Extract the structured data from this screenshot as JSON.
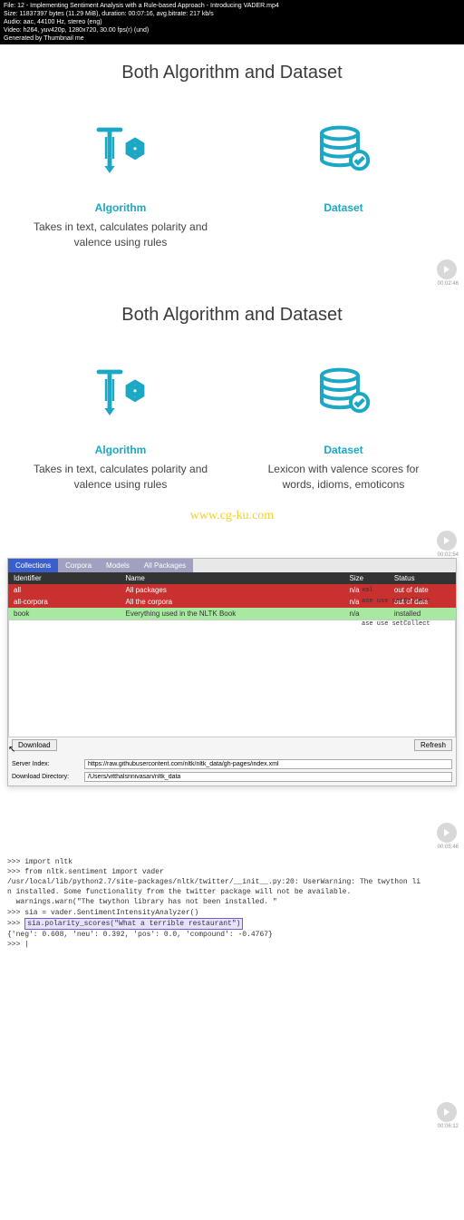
{
  "meta": {
    "file": "File: 12 - Implementing Sentiment Analysis with a Rule-based Approach - Introducing VADER.mp4",
    "size": "Size: 11837397 bytes (11.29 MiB), duration: 00:07:16, avg.bitrate: 217 kb/s",
    "audio": "Audio: aac, 44100 Hz, stereo (eng)",
    "video": "Video: h264, yuv420p, 1280x720, 30.00 fps(r) (und)",
    "gen": "Generated by Thumbnail me"
  },
  "slide1": {
    "title": "Both Algorithm and Dataset",
    "left": {
      "label": "Algorithm",
      "desc": "Takes in text, calculates polarity and valence using rules"
    },
    "right": {
      "label": "Dataset",
      "desc": ""
    },
    "timestamp": "00:02:46"
  },
  "slide2": {
    "title": "Both Algorithm and Dataset",
    "left": {
      "label": "Algorithm",
      "desc": "Takes in text, calculates polarity and valence using rules"
    },
    "right": {
      "label": "Dataset",
      "desc": "Lexicon with valence scores for words, idioms, emoticons"
    },
    "timestamp": "00:02:54"
  },
  "watermark": "www.cg-ku.com",
  "nltk": {
    "tabs": [
      "Collections",
      "Corpora",
      "Models",
      "All Packages"
    ],
    "headers": [
      "Identifier",
      "Name",
      "Size",
      "Status"
    ],
    "rows": [
      {
        "id": "all",
        "name": "All packages",
        "size": "n/a",
        "status": "out of date",
        "cls": "row-red"
      },
      {
        "id": "all-corpora",
        "name": "All the corpora",
        "size": "n/a",
        "status": "out of date",
        "cls": "row-red"
      },
      {
        "id": "book",
        "name": "Everything used in the NLTK Book",
        "size": "n/a",
        "status": "installed",
        "cls": "row-green"
      }
    ],
    "download": "Download",
    "refresh": "Refresh",
    "server_label": "Server Index:",
    "server_value": "https://raw.githubusercontent.com/nltk/nltk_data/gh-pages/index.xml",
    "dir_label": "Download Directory:",
    "dir_value": "/Users/vitthalsrinivasan/nltk_data",
    "side1": "xml",
    "side2": "ase use setCollect",
    "side3": "ase use setCollect",
    "timestamp": "00:05:46"
  },
  "terminal": {
    "l1": ">>> import nltk",
    "l2": ">>> from nltk.sentiment import vader",
    "l3": "/usr/local/lib/python2.7/site-packages/nltk/twitter/__init__.py:20: UserWarning: The twython li",
    "l4": "n installed. Some functionality from the twitter package will not be available.",
    "l5": "  warnings.warn(\"The twython library has not been installed. \"",
    "l6": ">>> sia = vader.SentimentIntensityAnalyzer()",
    "l7": ">>> ",
    "l7h": "sia.polarity_scores(\"What a terrible restaurant\")",
    "l8": "{'neg': 0.608, 'neu': 0.392, 'pos': 0.0, 'compound': -0.4767}",
    "l9": ">>> |",
    "timestamp": "00:06:12"
  }
}
